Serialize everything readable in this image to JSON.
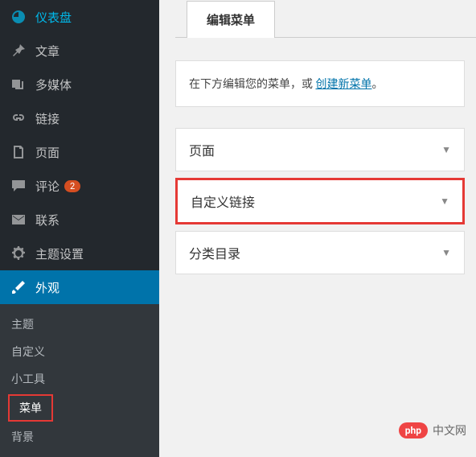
{
  "sidebar": {
    "items": [
      {
        "label": "仪表盘",
        "icon": "dashboard"
      },
      {
        "label": "文章",
        "icon": "pin"
      },
      {
        "label": "多媒体",
        "icon": "media"
      },
      {
        "label": "链接",
        "icon": "link"
      },
      {
        "label": "页面",
        "icon": "page"
      },
      {
        "label": "评论",
        "icon": "comment",
        "badge": "2"
      },
      {
        "label": "联系",
        "icon": "mail"
      },
      {
        "label": "主题设置",
        "icon": "gear"
      },
      {
        "label": "外观",
        "icon": "brush",
        "active": true
      }
    ],
    "submenu": [
      {
        "label": "主题"
      },
      {
        "label": "自定义"
      },
      {
        "label": "小工具"
      },
      {
        "label": "菜单",
        "highlight": true
      },
      {
        "label": "背景"
      }
    ]
  },
  "content": {
    "tab_label": "编辑菜单",
    "helper_prefix": "在下方编辑您的菜单，或",
    "helper_link": "创建新菜单",
    "helper_suffix": "。",
    "accordions": [
      {
        "label": "页面"
      },
      {
        "label": "自定义链接",
        "highlight": true
      },
      {
        "label": "分类目录"
      }
    ]
  },
  "watermark": {
    "badge": "php",
    "text": "中文网"
  }
}
